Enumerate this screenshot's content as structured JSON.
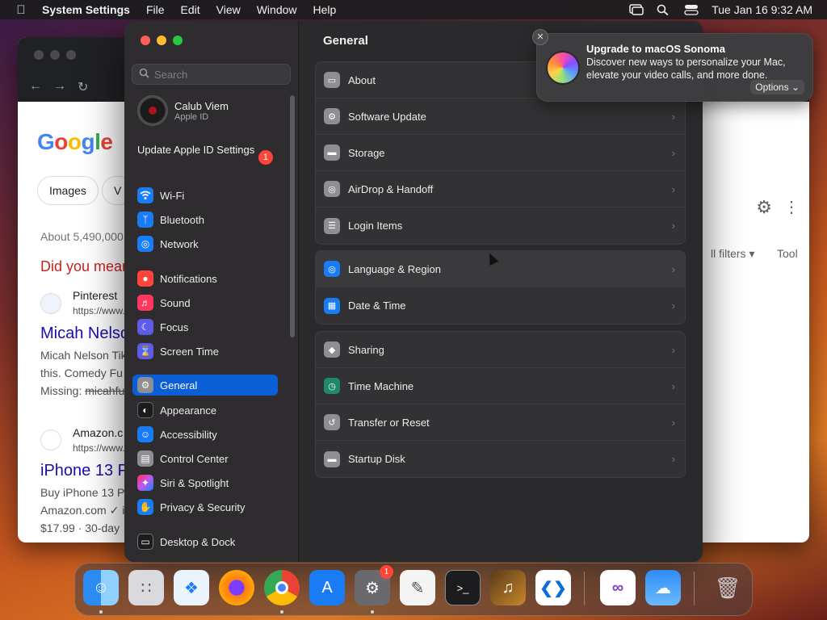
{
  "menubar": {
    "app_name": "System Settings",
    "menus": [
      "File",
      "Edit",
      "View",
      "Window",
      "Help"
    ],
    "clock": "Tue Jan 16  9:32 AM"
  },
  "browser": {
    "chips": [
      "Images",
      "V"
    ],
    "results_stats": "About 5,490,000",
    "did_you_mean": "Did you mean",
    "result1_site": "Pinterest",
    "result1_url": "https://www.",
    "result1_title": "Micah Nelso",
    "result1_text1": "Micah Nelson Tik",
    "result1_text2": "this. Comedy Fu",
    "result1_missing": "Missing:",
    "result1_missing_term": "micahfu",
    "result2_site": "Amazon.c",
    "result2_url": "https://www.",
    "result2_title": "iPhone 13 P",
    "result2_text1": "Buy iPhone 13 P",
    "result2_text2": "Amazon.com ✓ i",
    "result2_text3": "$17.99 · 30-day",
    "filters": "ll filters",
    "tools": "Tool"
  },
  "settings": {
    "search_placeholder": "Search",
    "profile_name": "Calub Viem",
    "profile_sub": "Apple ID",
    "update_label": "Update Apple ID Settings",
    "update_badge": "1",
    "sidebar": [
      {
        "label": "Wi-Fi",
        "icon": "wifi-icon",
        "color": "#1a7cf5"
      },
      {
        "label": "Bluetooth",
        "icon": "bluetooth-icon",
        "color": "#1a7cf5"
      },
      {
        "label": "Network",
        "icon": "globe-icon",
        "color": "#1a7cf5"
      },
      {
        "label": "Notifications",
        "icon": "bell-icon",
        "color": "#ff453a"
      },
      {
        "label": "Sound",
        "icon": "speaker-icon",
        "color": "#ff375f"
      },
      {
        "label": "Focus",
        "icon": "moon-icon",
        "color": "#5e5ce6"
      },
      {
        "label": "Screen Time",
        "icon": "hourglass-icon",
        "color": "#5e5ce6"
      },
      {
        "label": "General",
        "icon": "gear-icon",
        "color": "#8e8e93"
      },
      {
        "label": "Appearance",
        "icon": "appearance-icon",
        "color": "#1c1c1e"
      },
      {
        "label": "Accessibility",
        "icon": "accessibility-icon",
        "color": "#1a7cf5"
      },
      {
        "label": "Control Center",
        "icon": "control-center-icon",
        "color": "#8e8e93"
      },
      {
        "label": "Siri & Spotlight",
        "icon": "siri-icon",
        "color": "#bf5af2"
      },
      {
        "label": "Privacy & Security",
        "icon": "hand-icon",
        "color": "#1a7cf5"
      },
      {
        "label": "Desktop & Dock",
        "icon": "dock-icon",
        "color": "#1c1c1e"
      }
    ],
    "main_title": "General",
    "group1": [
      {
        "label": "About",
        "icon": "about-icon"
      },
      {
        "label": "Software Update",
        "icon": "software-update-icon"
      },
      {
        "label": "Storage",
        "icon": "storage-icon"
      },
      {
        "label": "AirDrop & Handoff",
        "icon": "airdrop-icon"
      },
      {
        "label": "Login Items",
        "icon": "login-items-icon"
      }
    ],
    "group2": [
      {
        "label": "Language & Region",
        "icon": "globe-icon"
      },
      {
        "label": "Date & Time",
        "icon": "calendar-icon"
      }
    ],
    "group3": [
      {
        "label": "Sharing",
        "icon": "sharing-icon"
      },
      {
        "label": "Time Machine",
        "icon": "time-machine-icon"
      },
      {
        "label": "Transfer or Reset",
        "icon": "reset-icon"
      },
      {
        "label": "Startup Disk",
        "icon": "disk-icon"
      }
    ]
  },
  "notification": {
    "title": "Upgrade to macOS Sonoma",
    "body": "Discover new ways to personalize your Mac, elevate your video calls, and more done.",
    "options": "Options"
  },
  "dock": {
    "apps": [
      "Finder",
      "Launchpad",
      "Safari",
      "Firefox",
      "Chrome",
      "App Store",
      "System Settings",
      "TextEdit",
      "Terminal",
      "GarageBand",
      "VS Code",
      "Visual Studio",
      "Weather",
      "Trash"
    ],
    "settings_badge": "1"
  }
}
